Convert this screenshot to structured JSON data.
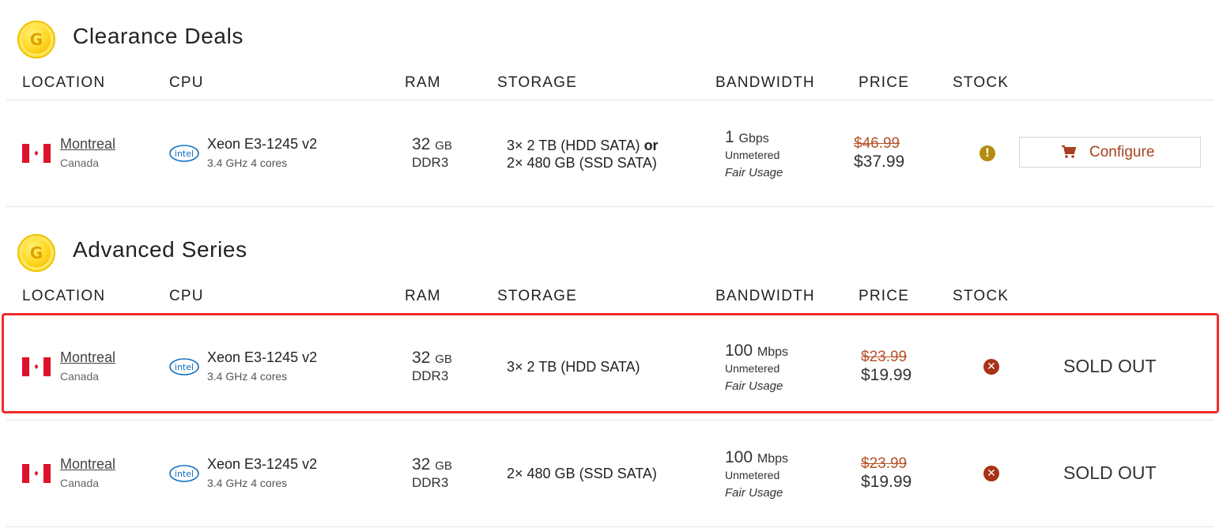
{
  "columns": {
    "location": "LOCATION",
    "cpu": "CPU",
    "ram": "RAM",
    "storage": "STORAGE",
    "bandwidth": "BANDWIDTH",
    "price": "PRICE",
    "stock": "STOCK"
  },
  "sections": [
    {
      "title": "Clearance Deals",
      "coin_letter": "G",
      "rows": [
        {
          "city": "Montreal",
          "country": "Canada",
          "cpu_logo": "intel",
          "cpu_name": "Xeon E3-1245 v2",
          "cpu_spec": "3.4 GHz 4 cores",
          "ram_num": "32",
          "ram_unit": "GB",
          "ram_type": "DDR3",
          "storage_line1": "3× 2 TB (HDD SATA)",
          "storage_or": "or",
          "storage_line2": "2× 480 GB (SSD SATA)",
          "bw_num": "1",
          "bw_unit": "Gbps",
          "bw_unmetered": "Unmetered",
          "bw_fair": "Fair Usage",
          "price_old": "$46.99",
          "price_new": "$37.99",
          "stock_status": "low",
          "stock_icon": "!",
          "action_label": "Configure"
        }
      ]
    },
    {
      "title": "Advanced Series",
      "coin_letter": "G",
      "rows": [
        {
          "city": "Montreal",
          "country": "Canada",
          "cpu_logo": "intel",
          "cpu_name": "Xeon E3-1245 v2",
          "cpu_spec": "3.4 GHz 4 cores",
          "ram_num": "32",
          "ram_unit": "GB",
          "ram_type": "DDR3",
          "storage_line1": "3× 2 TB (HDD SATA)",
          "bw_num": "100",
          "bw_unit": "Mbps",
          "bw_unmetered": "Unmetered",
          "bw_fair": "Fair Usage",
          "price_old": "$23.99",
          "price_new": "$19.99",
          "stock_status": "out",
          "stock_icon": "✕",
          "action_label": "SOLD OUT"
        },
        {
          "city": "Montreal",
          "country": "Canada",
          "cpu_logo": "intel",
          "cpu_name": "Xeon E3-1245 v2",
          "cpu_spec": "3.4 GHz 4 cores",
          "ram_num": "32",
          "ram_unit": "GB",
          "ram_type": "DDR3",
          "storage_line1": "2× 480 GB (SSD SATA)",
          "bw_num": "100",
          "bw_unit": "Mbps",
          "bw_unmetered": "Unmetered",
          "bw_fair": "Fair Usage",
          "price_old": "$23.99",
          "price_new": "$19.99",
          "stock_status": "out",
          "stock_icon": "✕",
          "action_label": "SOLD OUT"
        }
      ]
    }
  ],
  "colors": {
    "accent": "#a8401d",
    "strike_price": "#b5532b",
    "warn": "#b58a10",
    "sold_out": "#a83215",
    "highlight": "#f42b2b"
  }
}
